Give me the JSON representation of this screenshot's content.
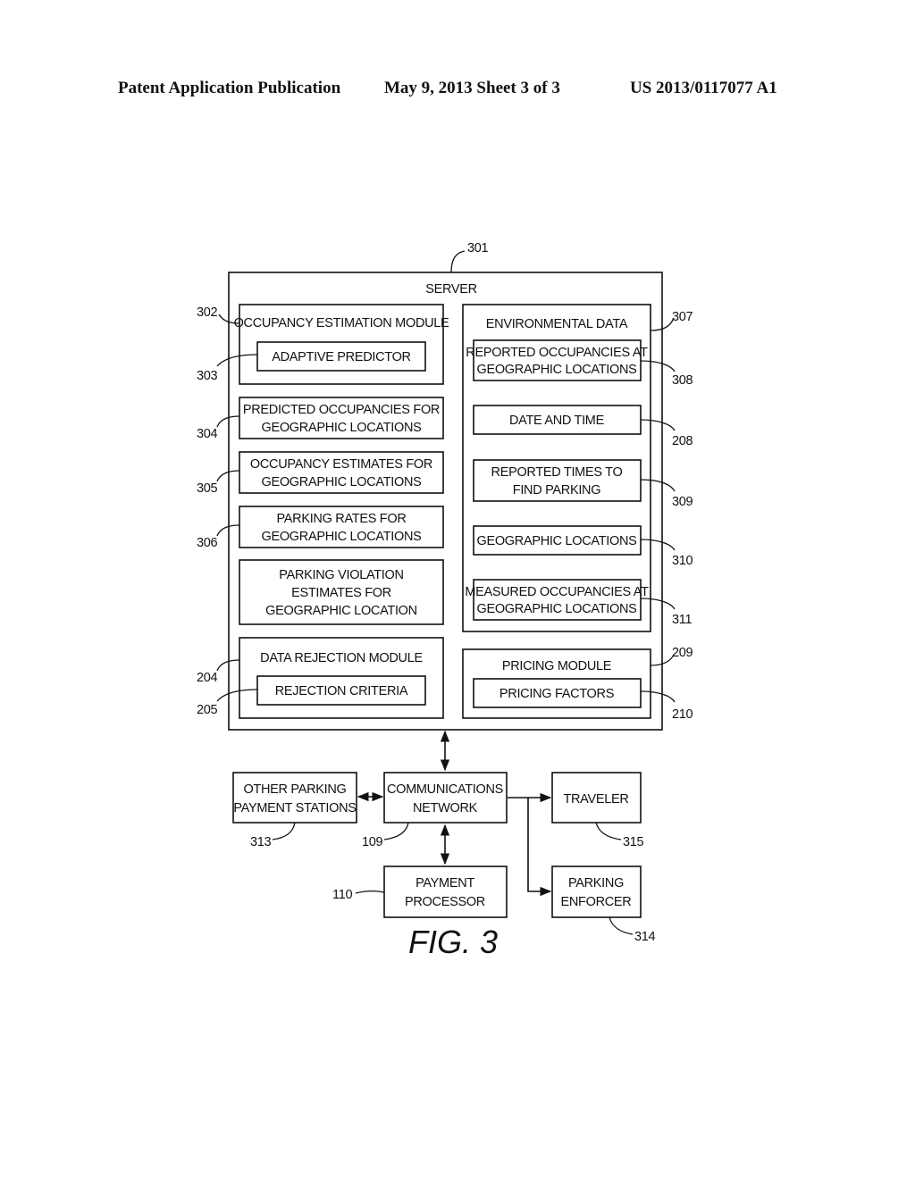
{
  "header": {
    "publication": "Patent Application Publication",
    "date_sheet": "May 9, 2013   Sheet 3 of 3",
    "number": "US 2013/0117077 A1"
  },
  "figure_label": "FIG. 3",
  "server": {
    "ref": "301",
    "title": "SERVER",
    "left_column": [
      {
        "ref": "302",
        "lines": [
          "OCCUPANCY ESTIMATION MODULE"
        ],
        "child": {
          "ref": "303",
          "lines": [
            "ADAPTIVE PREDICTOR"
          ]
        }
      },
      {
        "ref": "304",
        "lines": [
          "PREDICTED OCCUPANCIES FOR",
          "GEOGRAPHIC LOCATIONS"
        ]
      },
      {
        "ref": "305",
        "lines": [
          "OCCUPANCY ESTIMATES FOR",
          "GEOGRAPHIC LOCATIONS"
        ]
      },
      {
        "ref": "306",
        "lines": [
          "PARKING RATES FOR",
          "GEOGRAPHIC LOCATIONS"
        ]
      },
      {
        "ref": "",
        "lines": [
          "PARKING VIOLATION",
          "ESTIMATES FOR",
          "GEOGRAPHIC LOCATION"
        ]
      },
      {
        "ref": "204",
        "lines": [
          "DATA REJECTION MODULE"
        ],
        "child": {
          "ref": "205",
          "lines": [
            "REJECTION CRITERIA"
          ]
        }
      }
    ],
    "environmental": {
      "ref": "307",
      "title": "ENVIRONMENTAL DATA",
      "items": [
        {
          "ref": "308",
          "lines": [
            "REPORTED OCCUPANCIES AT",
            "GEOGRAPHIC LOCATIONS"
          ]
        },
        {
          "ref": "208",
          "lines": [
            "DATE AND TIME"
          ]
        },
        {
          "ref": "309",
          "lines": [
            "REPORTED TIMES TO",
            "FIND PARKING"
          ]
        },
        {
          "ref": "310",
          "lines": [
            "GEOGRAPHIC LOCATIONS"
          ]
        },
        {
          "ref": "311",
          "lines": [
            "MEASURED OCCUPANCIES AT",
            "GEOGRAPHIC LOCATIONS"
          ]
        }
      ]
    },
    "pricing": {
      "ref": "209",
      "title": "PRICING MODULE",
      "child": {
        "ref": "210",
        "lines": [
          "PRICING FACTORS"
        ]
      }
    }
  },
  "external": {
    "other_stations": {
      "ref": "313",
      "lines": [
        "OTHER PARKING",
        "PAYMENT STATIONS"
      ]
    },
    "network": {
      "ref": "109",
      "lines": [
        "COMMUNICATIONS",
        "NETWORK"
      ]
    },
    "traveler": {
      "ref": "315",
      "lines": [
        "TRAVELER"
      ]
    },
    "payment_processor": {
      "ref": "110",
      "lines": [
        "PAYMENT",
        "PROCESSOR"
      ]
    },
    "enforcer": {
      "ref": "314",
      "lines": [
        "PARKING",
        "ENFORCER"
      ]
    }
  }
}
